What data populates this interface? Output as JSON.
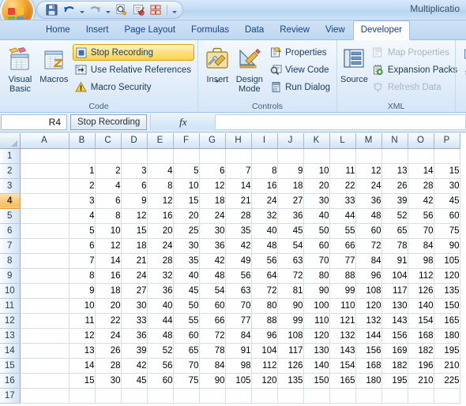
{
  "window": {
    "title": "Multiplicatio"
  },
  "quick_access": {
    "items": [
      {
        "name": "save-icon",
        "label": "Save"
      },
      {
        "name": "undo-icon",
        "label": "Undo"
      },
      {
        "name": "redo-icon",
        "label": "Redo"
      },
      {
        "name": "print-preview-icon",
        "label": "Print Preview"
      },
      {
        "name": "spelling-icon",
        "label": "Spelling"
      },
      {
        "name": "grid-tool-icon",
        "label": "Customize"
      }
    ],
    "customize_label": "Customize Quick Access Toolbar"
  },
  "tabs": [
    {
      "label": "Home",
      "active": false
    },
    {
      "label": "Insert",
      "active": false
    },
    {
      "label": "Page Layout",
      "active": false
    },
    {
      "label": "Formulas",
      "active": false
    },
    {
      "label": "Data",
      "active": false
    },
    {
      "label": "Review",
      "active": false
    },
    {
      "label": "View",
      "active": false
    },
    {
      "label": "Developer",
      "active": true
    }
  ],
  "ribbon": {
    "groups": [
      {
        "label": "Code",
        "big_buttons": [
          {
            "label": "Visual\nBasic",
            "line1": "Visual",
            "line2": "Basic",
            "icon": "visual-basic-icon"
          },
          {
            "label": "Macros",
            "line1": "Macros",
            "line2": "",
            "icon": "macros-icon"
          }
        ],
        "small_buttons": [
          {
            "label": "Stop Recording",
            "icon": "stop-recording-icon",
            "state": "toggled"
          },
          {
            "label": "Use Relative References",
            "icon": "relative-references-icon",
            "state": "normal"
          },
          {
            "label": "Macro Security",
            "icon": "macro-security-icon",
            "state": "normal"
          }
        ]
      },
      {
        "label": "Controls",
        "big_buttons": [
          {
            "label": "Insert",
            "line1": "Insert",
            "line2": "",
            "icon": "insert-control-icon",
            "dropdown": true
          },
          {
            "label": "Design Mode",
            "line1": "Design",
            "line2": "Mode",
            "icon": "design-mode-icon"
          }
        ],
        "small_buttons": [
          {
            "label": "Properties",
            "icon": "properties-icon",
            "state": "normal"
          },
          {
            "label": "View Code",
            "icon": "view-code-icon",
            "state": "normal"
          },
          {
            "label": "Run Dialog",
            "icon": "run-dialog-icon",
            "state": "normal"
          }
        ]
      },
      {
        "label": "XML",
        "big_buttons": [
          {
            "label": "Source",
            "line1": "Source",
            "line2": "",
            "icon": "xml-source-icon"
          }
        ],
        "small_buttons": [
          {
            "label": "Map Properties",
            "icon": "map-properties-icon",
            "state": "disabled"
          },
          {
            "label": "Expansion Packs",
            "icon": "expansion-packs-icon",
            "state": "normal"
          },
          {
            "label": "Refresh Data",
            "icon": "refresh-data-icon",
            "state": "disabled"
          }
        ]
      }
    ]
  },
  "formula_bar": {
    "name_box": "R4",
    "record_button": "Stop Recording",
    "fx_label": "fx",
    "formula_value": ""
  },
  "sheet": {
    "columns": [
      "A",
      "B",
      "C",
      "D",
      "E",
      "F",
      "G",
      "H",
      "I",
      "J",
      "K",
      "L",
      "M",
      "N",
      "O",
      "P"
    ],
    "selected_row": 4,
    "rows": [
      {
        "num": 1,
        "cells": [
          "",
          "",
          "",
          "",
          "",
          "",
          "",
          "",
          "",
          "",
          "",
          "",
          "",
          "",
          "",
          ""
        ]
      },
      {
        "num": 2,
        "cells": [
          "",
          "1",
          "2",
          "3",
          "4",
          "5",
          "6",
          "7",
          "8",
          "9",
          "10",
          "11",
          "12",
          "13",
          "14",
          "15"
        ]
      },
      {
        "num": 3,
        "cells": [
          "",
          "2",
          "4",
          "6",
          "8",
          "10",
          "12",
          "14",
          "16",
          "18",
          "20",
          "22",
          "24",
          "26",
          "28",
          "30"
        ]
      },
      {
        "num": 4,
        "cells": [
          "",
          "3",
          "6",
          "9",
          "12",
          "15",
          "18",
          "21",
          "24",
          "27",
          "30",
          "33",
          "36",
          "39",
          "42",
          "45"
        ]
      },
      {
        "num": 5,
        "cells": [
          "",
          "4",
          "8",
          "12",
          "16",
          "20",
          "24",
          "28",
          "32",
          "36",
          "40",
          "44",
          "48",
          "52",
          "56",
          "60"
        ]
      },
      {
        "num": 6,
        "cells": [
          "",
          "5",
          "10",
          "15",
          "20",
          "25",
          "30",
          "35",
          "40",
          "45",
          "50",
          "55",
          "60",
          "65",
          "70",
          "75"
        ]
      },
      {
        "num": 7,
        "cells": [
          "",
          "6",
          "12",
          "18",
          "24",
          "30",
          "36",
          "42",
          "48",
          "54",
          "60",
          "66",
          "72",
          "78",
          "84",
          "90"
        ]
      },
      {
        "num": 8,
        "cells": [
          "",
          "7",
          "14",
          "21",
          "28",
          "35",
          "42",
          "49",
          "56",
          "63",
          "70",
          "77",
          "84",
          "91",
          "98",
          "105"
        ]
      },
      {
        "num": 9,
        "cells": [
          "",
          "8",
          "16",
          "24",
          "32",
          "40",
          "48",
          "56",
          "64",
          "72",
          "80",
          "88",
          "96",
          "104",
          "112",
          "120"
        ]
      },
      {
        "num": 10,
        "cells": [
          "",
          "9",
          "18",
          "27",
          "36",
          "45",
          "54",
          "63",
          "72",
          "81",
          "90",
          "99",
          "108",
          "117",
          "126",
          "135"
        ]
      },
      {
        "num": 11,
        "cells": [
          "",
          "10",
          "20",
          "30",
          "40",
          "50",
          "60",
          "70",
          "80",
          "90",
          "100",
          "110",
          "120",
          "130",
          "140",
          "150"
        ]
      },
      {
        "num": 12,
        "cells": [
          "",
          "11",
          "22",
          "33",
          "44",
          "55",
          "66",
          "77",
          "88",
          "99",
          "110",
          "121",
          "132",
          "143",
          "154",
          "165"
        ]
      },
      {
        "num": 13,
        "cells": [
          "",
          "12",
          "24",
          "36",
          "48",
          "60",
          "72",
          "84",
          "96",
          "108",
          "120",
          "132",
          "144",
          "156",
          "168",
          "180"
        ]
      },
      {
        "num": 14,
        "cells": [
          "",
          "13",
          "26",
          "39",
          "52",
          "65",
          "78",
          "91",
          "104",
          "117",
          "130",
          "143",
          "156",
          "169",
          "182",
          "195"
        ]
      },
      {
        "num": 15,
        "cells": [
          "",
          "14",
          "28",
          "42",
          "56",
          "70",
          "84",
          "98",
          "112",
          "126",
          "140",
          "154",
          "168",
          "182",
          "196",
          "210"
        ]
      },
      {
        "num": 16,
        "cells": [
          "",
          "15",
          "30",
          "45",
          "60",
          "75",
          "90",
          "105",
          "120",
          "135",
          "150",
          "165",
          "180",
          "195",
          "210",
          "225"
        ]
      },
      {
        "num": 17,
        "cells": [
          "",
          "",
          "",
          "",
          "",
          "",
          "",
          "",
          "",
          "",
          "",
          "",
          "",
          "",
          "",
          ""
        ]
      }
    ]
  },
  "colors": {
    "tab_active_bg": "#fdfdfd",
    "tab_text": "#15428b",
    "selection_header": "#f9c97a",
    "toggle_highlight": "#ffdf7d",
    "grid_line": "#d6dfe8"
  }
}
